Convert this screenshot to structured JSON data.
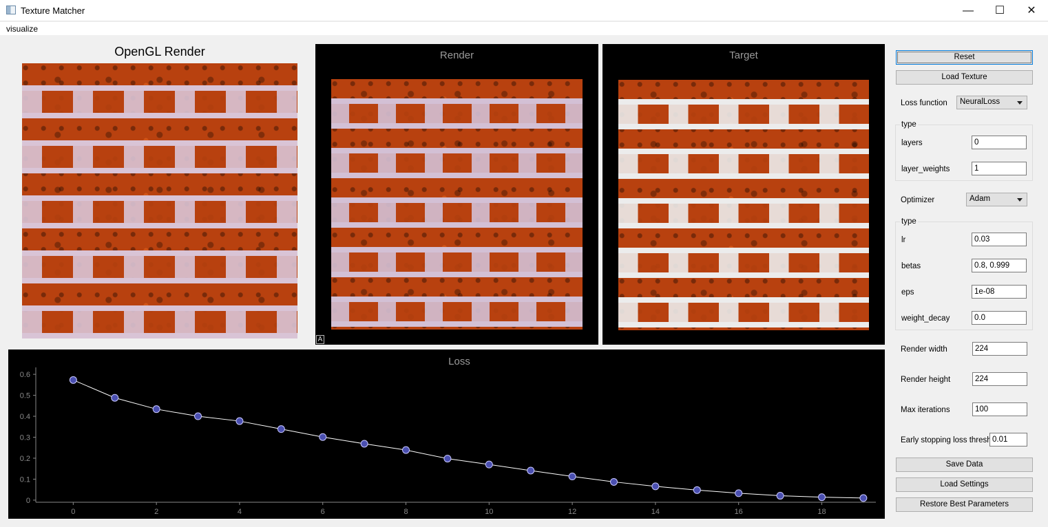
{
  "window": {
    "title": "Texture Matcher",
    "minimize_glyph": "—",
    "maximize_glyph": "☐",
    "close_glyph": "✕"
  },
  "menu": {
    "items": [
      "visualize"
    ]
  },
  "panels": {
    "opengl_title": "OpenGL Render",
    "render_title": "Render",
    "target_title": "Target",
    "loss_title": "Loss",
    "render_badge": "A"
  },
  "controls": {
    "reset_label": "Reset",
    "load_texture_label": "Load Texture",
    "loss_function_label": "Loss function",
    "loss_function_value": "NeuralLoss",
    "loss_group_title": "type",
    "layers_label": "layers",
    "layers_value": "0",
    "layer_weights_label": "layer_weights",
    "layer_weights_value": "1",
    "optimizer_label": "Optimizer",
    "optimizer_value": "Adam",
    "optimizer_group_title": "type",
    "lr_label": "lr",
    "lr_value": "0.03",
    "betas_label": "betas",
    "betas_value": "0.8, 0.999",
    "eps_label": "eps",
    "eps_value": "1e-08",
    "weight_decay_label": "weight_decay",
    "weight_decay_value": "0.0",
    "render_width_label": "Render width",
    "render_width_value": "224",
    "render_height_label": "Render height",
    "render_height_value": "224",
    "max_iterations_label": "Max iterations",
    "max_iterations_value": "100",
    "early_stop_label": "Early stopping loss thresh",
    "early_stop_value": "0.01",
    "save_data_label": "Save Data",
    "load_settings_label": "Load Settings",
    "restore_label": "Restore Best Parameters"
  },
  "colors": {
    "brick": "#b8410f",
    "brick_dark": "#5a1a06",
    "mortar_opengl": "#d9c4d6",
    "mortar_render": "#d3c0d5",
    "mortar_target": "#ececec",
    "loss_line": "#ffffff",
    "loss_marker": "#4a4fb0",
    "axis": "#8a8a8a"
  },
  "chart_data": {
    "type": "line",
    "title": "Loss",
    "xlabel": "",
    "ylabel": "",
    "x": [
      0,
      1,
      2,
      3,
      4,
      5,
      6,
      7,
      8,
      9,
      10,
      11,
      12,
      13,
      14,
      15,
      16,
      17,
      18,
      19
    ],
    "series": [
      {
        "values": [
          0.573,
          0.488,
          0.434,
          0.4,
          0.377,
          0.339,
          0.301,
          0.269,
          0.239,
          0.198,
          0.17,
          0.141,
          0.113,
          0.087,
          0.066,
          0.048,
          0.033,
          0.021,
          0.014,
          0.01
        ]
      }
    ],
    "xticks": [
      "0",
      "2",
      "4",
      "6",
      "8",
      "10",
      "12",
      "14",
      "16",
      "18"
    ],
    "yticks": [
      "0",
      "0.1",
      "0.2",
      "0.3",
      "0.4",
      "0.5",
      "0.6"
    ],
    "xlim": [
      -0.9,
      19.3
    ],
    "ylim": [
      -0.01,
      0.62
    ],
    "grid": false
  }
}
